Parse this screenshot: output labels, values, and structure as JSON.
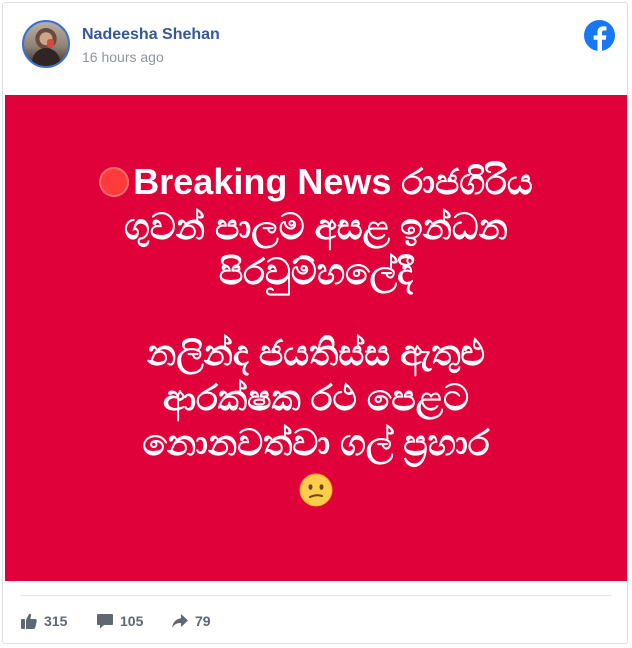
{
  "post": {
    "author_name": "Nadeesha Shehan",
    "timestamp": "16 hours ago",
    "platform_icon": "facebook-icon",
    "image_text": {
      "line1": "Breaking News රාජගිරිය",
      "line2": "ගුවන් පාලම අසළ ඉන්ධන",
      "line3": "පිරවුම්හලේදී",
      "line4": "නලින්ද ජයතිස්ස ඇතුළු",
      "line5": "ආරක්ෂක රථ පෙළට",
      "line6": "නොනවත්වා ගල් ප්‍රහාර"
    },
    "image_background": "#e0003a"
  },
  "stats": {
    "likes": "315",
    "comments": "105",
    "shares": "79"
  },
  "colors": {
    "author": "#365899",
    "facebook_blue": "#1877f2",
    "muted": "#90949c"
  }
}
